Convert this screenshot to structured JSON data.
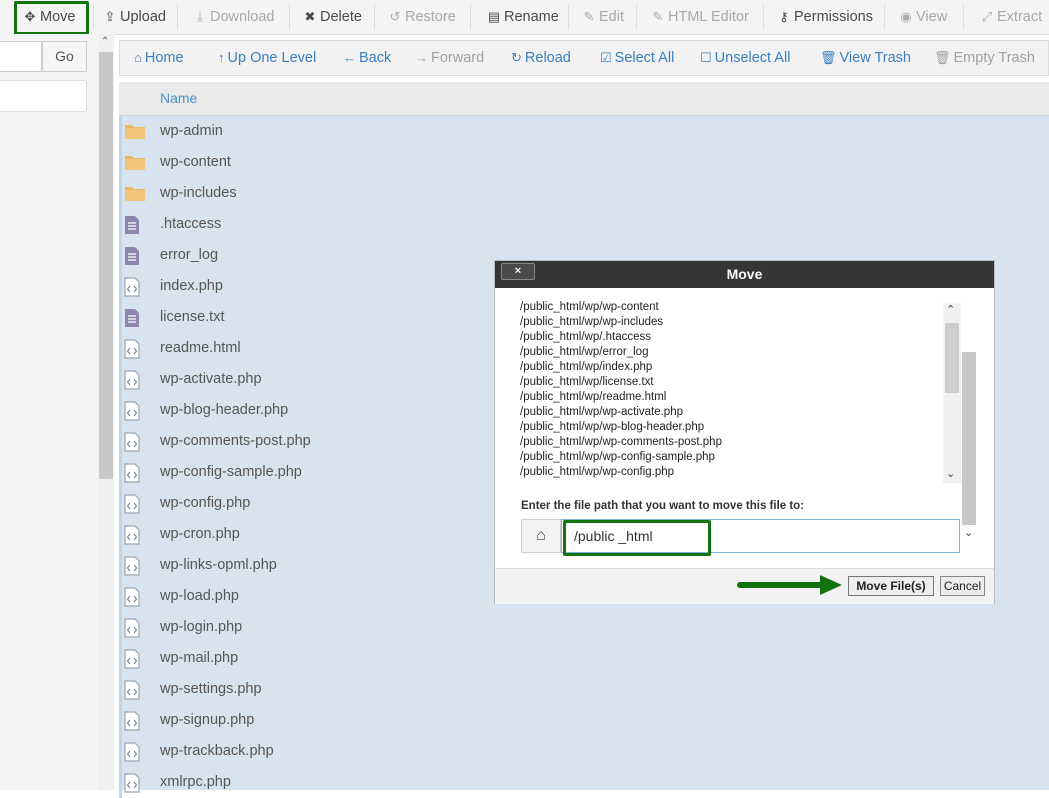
{
  "toolbar": {
    "items": [
      {
        "label": "Move",
        "icon": "move-icon",
        "enabled": true
      },
      {
        "label": "Upload",
        "icon": "upload-icon",
        "enabled": true
      },
      {
        "label": "Download",
        "icon": "download-icon",
        "enabled": false
      },
      {
        "label": "Delete",
        "icon": "delete-icon",
        "enabled": true
      },
      {
        "label": "Restore",
        "icon": "restore-icon",
        "enabled": false
      },
      {
        "label": "Rename",
        "icon": "rename-icon",
        "enabled": true
      },
      {
        "label": "Edit",
        "icon": "edit-icon",
        "enabled": false
      },
      {
        "label": "HTML Editor",
        "icon": "html-editor-icon",
        "enabled": false
      },
      {
        "label": "Permissions",
        "icon": "key-icon",
        "enabled": true
      },
      {
        "label": "View",
        "icon": "eye-icon",
        "enabled": false
      },
      {
        "label": "Extract",
        "icon": "extract-icon",
        "enabled": false
      }
    ]
  },
  "left": {
    "go_label": "Go"
  },
  "nav": {
    "items": [
      {
        "label": "Home",
        "icon": "home-icon",
        "enabled": true
      },
      {
        "label": "Up One Level",
        "icon": "up-arrow-icon",
        "enabled": true
      },
      {
        "label": "Back",
        "icon": "back-arrow-icon",
        "enabled": true
      },
      {
        "label": "Forward",
        "icon": "forward-arrow-icon",
        "enabled": false
      },
      {
        "label": "Reload",
        "icon": "reload-icon",
        "enabled": true
      },
      {
        "label": "Select All",
        "icon": "checkbox-checked-icon",
        "enabled": true
      },
      {
        "label": "Unselect All",
        "icon": "checkbox-empty-icon",
        "enabled": true
      },
      {
        "label": "View Trash",
        "icon": "trash-icon",
        "enabled": true
      },
      {
        "label": "Empty Trash",
        "icon": "trash-icon",
        "enabled": false
      }
    ]
  },
  "table": {
    "header_name": "Name",
    "files": [
      {
        "name": "wp-admin",
        "type": "folder"
      },
      {
        "name": "wp-content",
        "type": "folder"
      },
      {
        "name": "wp-includes",
        "type": "folder"
      },
      {
        "name": ".htaccess",
        "type": "text"
      },
      {
        "name": "error_log",
        "type": "text"
      },
      {
        "name": "index.php",
        "type": "code"
      },
      {
        "name": "license.txt",
        "type": "text"
      },
      {
        "name": "readme.html",
        "type": "code"
      },
      {
        "name": "wp-activate.php",
        "type": "code"
      },
      {
        "name": "wp-blog-header.php",
        "type": "code"
      },
      {
        "name": "wp-comments-post.php",
        "type": "code"
      },
      {
        "name": "wp-config-sample.php",
        "type": "code"
      },
      {
        "name": "wp-config.php",
        "type": "code"
      },
      {
        "name": "wp-cron.php",
        "type": "code"
      },
      {
        "name": "wp-links-opml.php",
        "type": "code"
      },
      {
        "name": "wp-load.php",
        "type": "code"
      },
      {
        "name": "wp-login.php",
        "type": "code"
      },
      {
        "name": "wp-mail.php",
        "type": "code"
      },
      {
        "name": "wp-settings.php",
        "type": "code"
      },
      {
        "name": "wp-signup.php",
        "type": "code"
      },
      {
        "name": "wp-trackback.php",
        "type": "code"
      },
      {
        "name": "xmlrpc.php",
        "type": "code"
      }
    ]
  },
  "dialog": {
    "title": "Move",
    "close_label": "×",
    "file_list": [
      "/public_html/wp/wp-content",
      "/public_html/wp/wp-includes",
      "/public_html/wp/.htaccess",
      "/public_html/wp/error_log",
      "/public_html/wp/index.php",
      "/public_html/wp/license.txt",
      "/public_html/wp/readme.html",
      "/public_html/wp/wp-activate.php",
      "/public_html/wp/wp-blog-header.php",
      "/public_html/wp/wp-comments-post.php",
      "/public_html/wp/wp-config-sample.php",
      "/public_html/wp/wp-config.php"
    ],
    "prompt": "Enter the file path that you want to move this file to:",
    "path_value": "/public _html",
    "move_button": "Move File(s)",
    "cancel_button": "Cancel"
  },
  "colors": {
    "highlight": "#12720f",
    "link": "#3c7fbf",
    "selection": "#d7e4ef"
  }
}
